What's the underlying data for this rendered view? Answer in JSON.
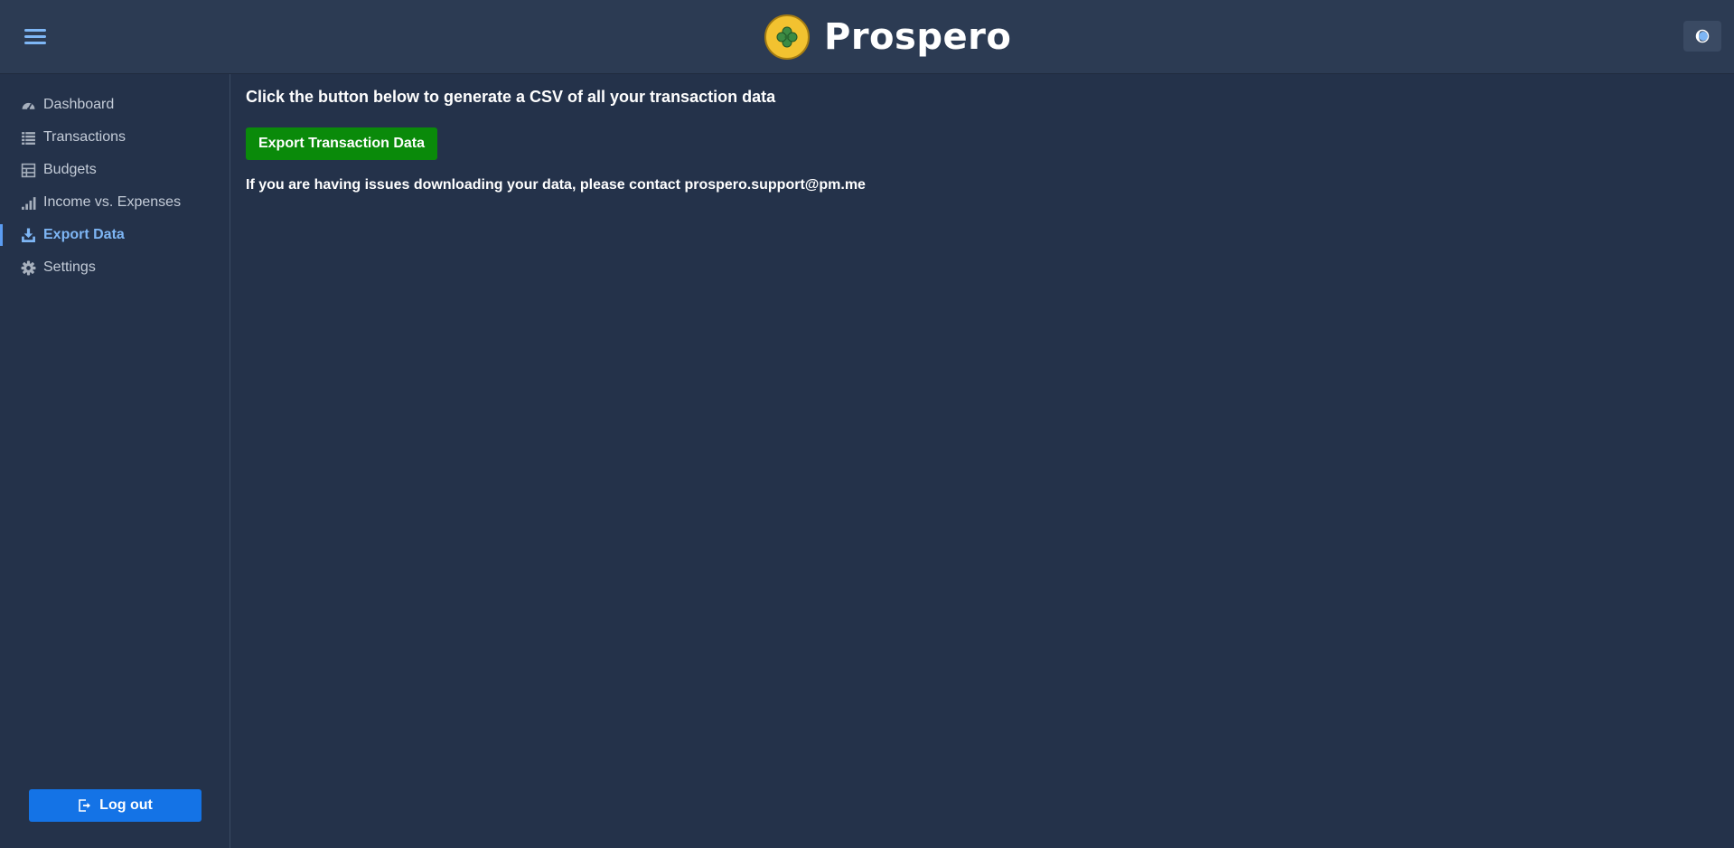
{
  "header": {
    "brand_name": "Prospero",
    "menu_icon": "hamburger-menu-icon",
    "logo_icon": "four-leaf-clover-icon",
    "theme_toggle_icon": "half-moon-icon"
  },
  "sidebar": {
    "items": [
      {
        "label": "Dashboard",
        "icon": "speedometer-icon",
        "active": false
      },
      {
        "label": "Transactions",
        "icon": "list-icon",
        "active": false
      },
      {
        "label": "Budgets",
        "icon": "table-icon",
        "active": false
      },
      {
        "label": "Income vs. Expenses",
        "icon": "bar-chart-icon",
        "active": false
      },
      {
        "label": "Export Data",
        "icon": "download-icon",
        "active": true
      },
      {
        "label": "Settings",
        "icon": "gear-icon",
        "active": false
      }
    ],
    "logout_label": "Log out",
    "logout_icon": "logout-icon"
  },
  "main": {
    "heading": "Click the button below to generate a CSV of all your transaction data",
    "export_button_label": "Export Transaction Data",
    "support_text": "If you are having issues downloading your data, please contact prospero.support@pm.me"
  },
  "colors": {
    "background": "#24324a",
    "header": "#2c3b53",
    "accent": "#7eb6f5",
    "export_button": "#0a8a0a",
    "logout_button": "#1473e6"
  }
}
